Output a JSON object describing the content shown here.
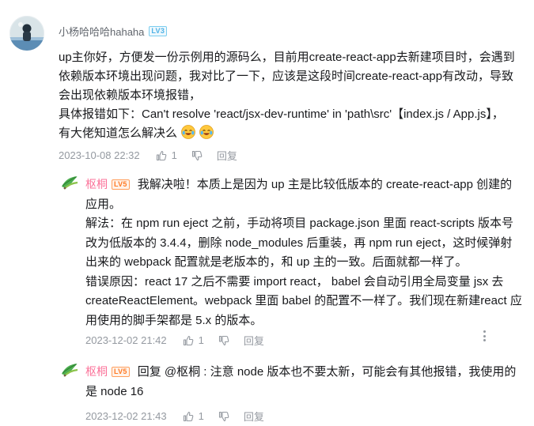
{
  "main_comment": {
    "username": "小杨哈哈哈hahaha",
    "level": "LV3",
    "content_lines": [
      "up主你好，方便发一份示例用的源码么，目前用create-react-app去新建项目时，会遇到",
      "依赖版本环境出现问题，我对比了一下，应该是这段时间create-react-app有改动，导致",
      "会出现依赖版本环境报错，",
      "具体报错如下：Can't resolve 'react/jsx-dev-runtime' in 'path\\src'【index.js / App.js】，",
      "有大佬知道怎么解决么"
    ],
    "emojis": [
      "crying-laughing-emoji",
      "crying-laughing-emoji"
    ],
    "time": "2023-10-08 22:32",
    "likes": "1",
    "reply_label": "回复"
  },
  "replies": [
    {
      "username": "枢桐",
      "level": "LV5",
      "content_lines": [
        "我解决啦！本质上是因为 up 主是比较低版本的 create-react-app 创建的",
        "应用。",
        "解法：在 npm run eject 之前，手动将项目 package.json 里面 react-scripts 版本号",
        "改为低版本的 3.4.4，删除 node_modules 后重装，再 npm run eject，这时候弹射",
        "出来的 webpack 配置就是老版本的，和 up 主的一致。后面就都一样了。",
        "错误原因：react 17 之后不需要 import react， babel 会自动引用全局变量 jsx 去",
        "createReactElement。webpack 里面 babel 的配置不一样了。我们现在新建react 应",
        "用使用的脚手架都是 5.x 的版本。"
      ],
      "time": "2023-12-02 21:42",
      "likes": "1",
      "reply_label": "回复"
    },
    {
      "username": "枢桐",
      "level": "LV5",
      "content_lines": [
        "回复 @枢桐 : 注意 node 版本也不要太新，可能会有其他报错，我使用的",
        "是 node 16"
      ],
      "time": "2023-12-02 21:43",
      "likes": "1",
      "reply_label": "回复"
    }
  ],
  "colors": {
    "username_reply": "#fb7299",
    "text": "#18191c",
    "meta": "#9499a0",
    "lv3": "#4fb2e6",
    "lv5": "#ff7a25"
  }
}
